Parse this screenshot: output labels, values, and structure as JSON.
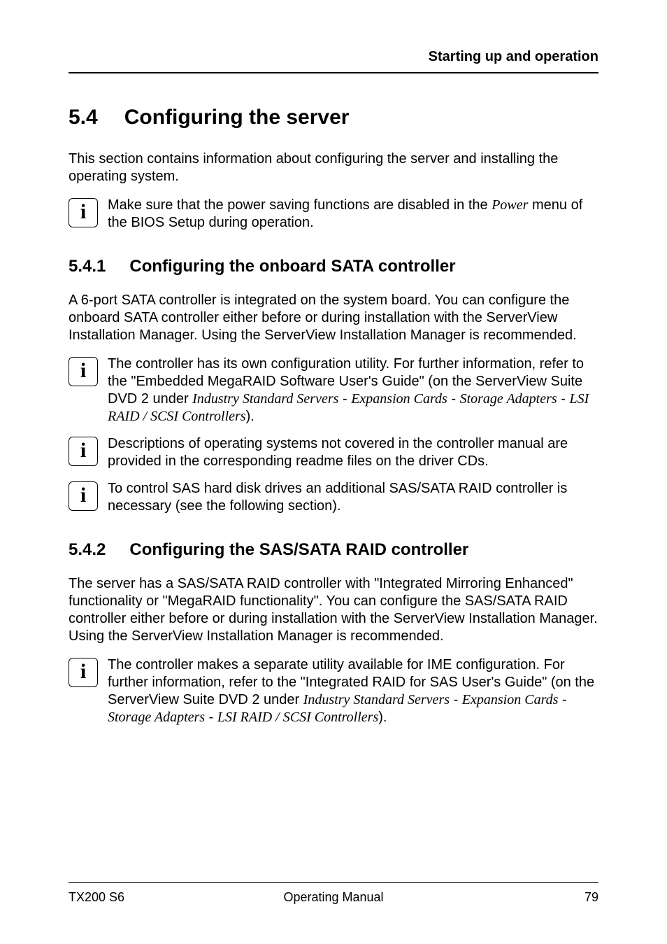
{
  "running_head": "Starting up and operation",
  "section": {
    "number": "5.4",
    "title": "Configuring the server",
    "intro": "This section contains information about configuring the server and installing the operating system.",
    "info1": {
      "pre": "Make sure that the power saving functions are disabled in the ",
      "ital": "Power",
      "post": " menu of the BIOS Setup during operation."
    }
  },
  "sub1": {
    "number": "5.4.1",
    "title": "Configuring the onboard SATA controller",
    "para": "A 6-port SATA controller is integrated on the system board. You can configure the onboard SATA controller either before or during installation with the ServerView Installation Manager. Using the ServerView Installation Manager is recommended.",
    "info1": {
      "l1": "The controller has its own configuration utility. For further information, refer to the \"Embedded MegaRAID Software User's Guide\" (on the ServerView Suite DVD 2 under ",
      "p1": "Industry Standard Servers",
      "s1": " - ",
      "p2": "Expansion Cards",
      "s2": " - ",
      "p3": "Storage Adapters",
      "s3": " - ",
      "p4": "LSI RAID / SCSI Controllers",
      "tail": ")."
    },
    "info2": "Descriptions of operating systems not covered in the controller manual are provided in the corresponding readme files on the driver CDs.",
    "info3": "To control SAS hard disk drives an additional SAS/SATA RAID controller is necessary (see the following section)."
  },
  "sub2": {
    "number": "5.4.2",
    "title": "Configuring the SAS/SATA RAID controller",
    "para": "The server has a SAS/SATA RAID controller with \"Integrated Mirroring Enhanced\" functionality or \"MegaRAID functionality\". You can configure the SAS/SATA RAID controller either before or during installation with the ServerView Installation Manager. Using the ServerView Installation Manager is recommended.",
    "info1": {
      "l1": "The controller makes a separate utility available for IME configuration. For further information, refer to the \"Integrated RAID for SAS User's Guide\" (on the ServerView Suite DVD 2 under ",
      "p1": "Industry Standard Servers",
      "s1": " - ",
      "p2": "Expansion Cards",
      "s2": " - ",
      "p3": "Storage Adapters",
      "s3": " - ",
      "p4": "LSI RAID / SCSI Controllers",
      "tail": ")."
    }
  },
  "footer": {
    "left": "TX200 S6",
    "center": "Operating Manual",
    "right": "79"
  },
  "icon_glyph": "i"
}
